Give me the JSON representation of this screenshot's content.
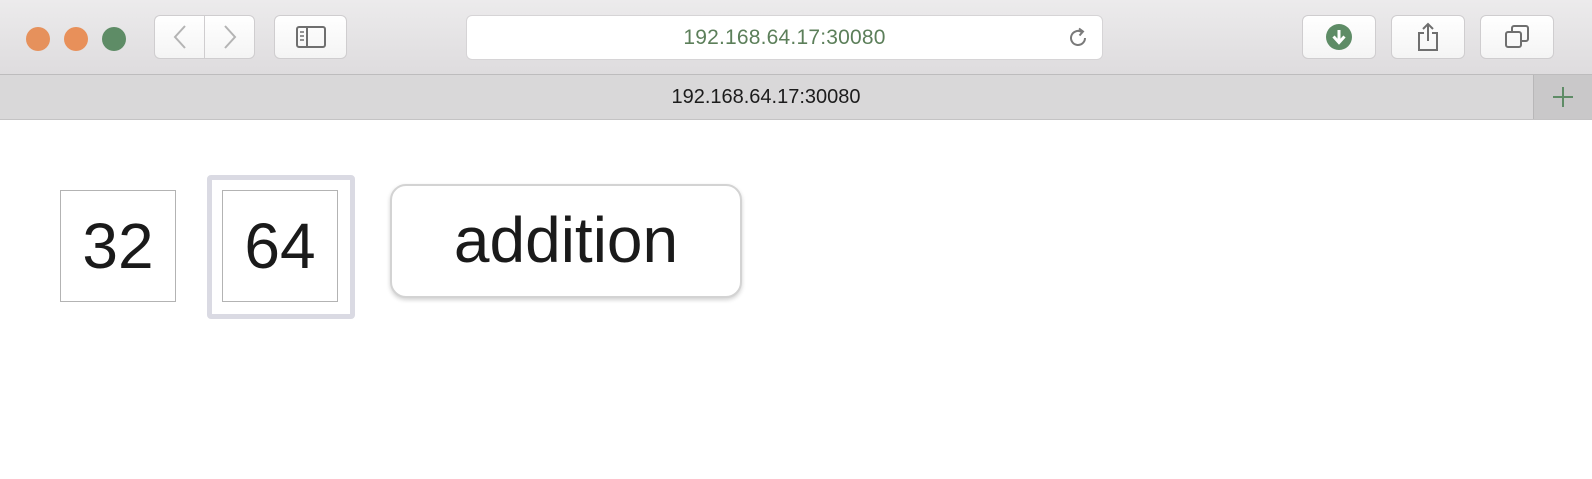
{
  "browser": {
    "address_bar": "192.168.64.17:30080",
    "tab_title": "192.168.64.17:30080",
    "accent_color": "#5c7f5a"
  },
  "icons": {
    "close": "close-window-icon",
    "minimize": "minimize-window-icon",
    "zoom": "zoom-window-icon",
    "back": "chevron-left-icon",
    "forward": "chevron-right-icon",
    "sidebar": "sidebar-icon",
    "reload": "reload-icon",
    "download": "download-icon",
    "share": "share-icon",
    "tabs": "tab-overview-icon",
    "new_tab": "plus-icon"
  },
  "page": {
    "first_input": "32",
    "second_input": "64",
    "button_label": "addition"
  }
}
